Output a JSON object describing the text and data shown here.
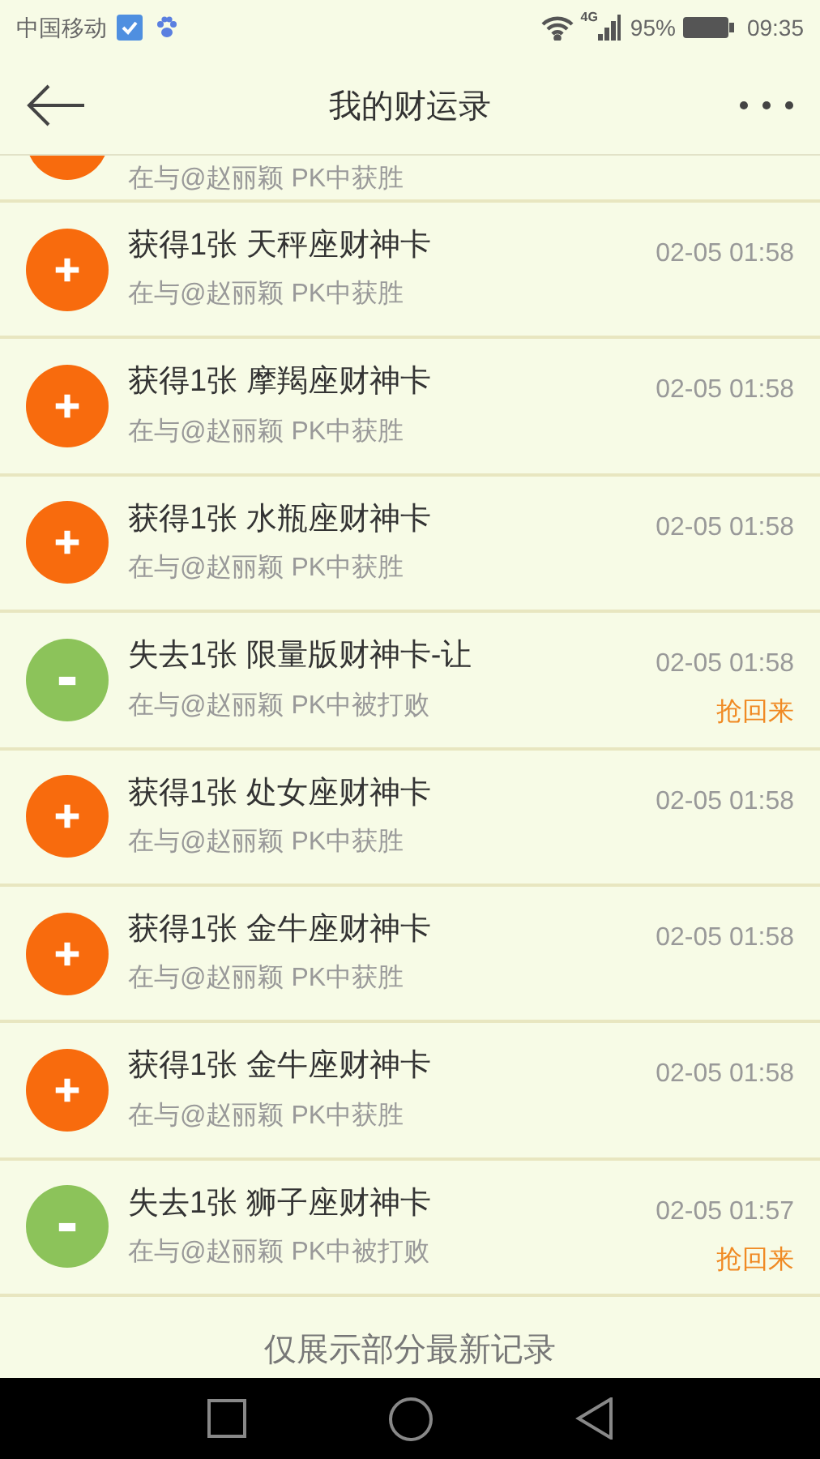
{
  "status_bar": {
    "carrier": "中国移动",
    "network": "4G",
    "battery": "95%",
    "time": "09:35"
  },
  "header": {
    "title": "我的财运录"
  },
  "partial_record": {
    "kind": "gain",
    "subtitle": "在与@赵丽颖 PK中获胜"
  },
  "records": [
    {
      "kind": "gain",
      "title": "获得1张 天秤座财神卡",
      "subtitle": "在与@赵丽颖 PK中获胜",
      "time": "02-05 01:58"
    },
    {
      "kind": "gain",
      "title": "获得1张 摩羯座财神卡",
      "subtitle": "在与@赵丽颖 PK中获胜",
      "time": "02-05 01:58"
    },
    {
      "kind": "gain",
      "title": "获得1张 水瓶座财神卡",
      "subtitle": "在与@赵丽颖 PK中获胜",
      "time": "02-05 01:58"
    },
    {
      "kind": "loss",
      "title": "失去1张 限量版财神卡-让",
      "subtitle": "在与@赵丽颖 PK中被打败",
      "time": "02-05 01:58",
      "action": "抢回来"
    },
    {
      "kind": "gain",
      "title": "获得1张 处女座财神卡",
      "subtitle": "在与@赵丽颖 PK中获胜",
      "time": "02-05 01:58"
    },
    {
      "kind": "gain",
      "title": "获得1张 金牛座财神卡",
      "subtitle": "在与@赵丽颖 PK中获胜",
      "time": "02-05 01:58"
    },
    {
      "kind": "gain",
      "title": "获得1张 金牛座财神卡",
      "subtitle": "在与@赵丽颖 PK中获胜",
      "time": "02-05 01:58"
    },
    {
      "kind": "loss",
      "title": "失去1张 狮子座财神卡",
      "subtitle": "在与@赵丽颖 PK中被打败",
      "time": "02-05 01:57",
      "action": "抢回来"
    }
  ],
  "footer": {
    "note": "仅展示部分最新记录"
  }
}
